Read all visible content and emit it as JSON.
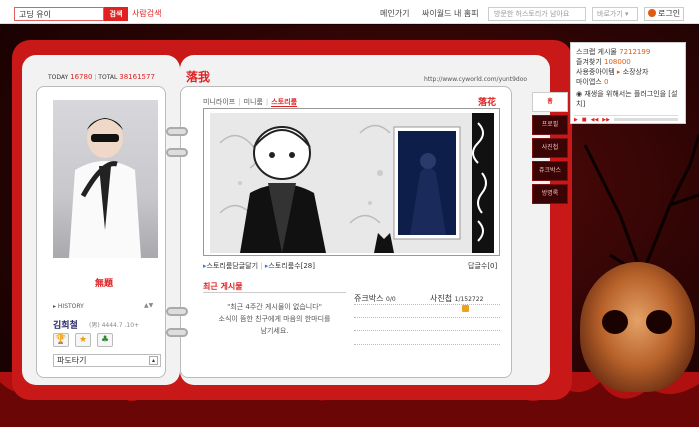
{
  "topbar": {
    "search_value": "고딩 유이",
    "search_button": "검색",
    "people_search": "사람검색",
    "main_link": "메인가기",
    "my_homepage": "싸이월드 내 홈피",
    "visitor_placeholder": "방문한 허스토리가 남아요",
    "goto_label": "바로가기",
    "login_label": "로그인"
  },
  "left": {
    "today_label": "TODAY",
    "today_count": "16780",
    "total_label": "TOTAL",
    "total_count": "38161577",
    "profile_name": "無題",
    "history_label": "HISTORY",
    "owner_name": "김희철",
    "owner_meta": "(男) 4444.7 .10+",
    "badges": [
      "🏆",
      "★",
      "♣"
    ],
    "pado_label": "파도타기"
  },
  "main": {
    "title": "落我",
    "url": "http://www.cyworld.com/yunt9doo",
    "tabs": [
      "미니라이프",
      "미니룸",
      "스토리룸"
    ],
    "tab_right": "落花",
    "story_link1": "스토리룸담글달기",
    "story_link2": "스토리룸수",
    "story_count": "[28]",
    "reply_count": "답글수[0]",
    "recent_title": "최근 게시물",
    "recent_line1": "\"최근 4주간 게시물이 없습니다\"",
    "recent_line2": "소식이 뜸한 친구에게 마음의 한마디를",
    "recent_line3": "남기세요.",
    "jukebox_label": "쥬크박스",
    "jukebox_value": "0/0",
    "photo_label": "사진첩",
    "photo_value": "1/152722"
  },
  "side_tabs": [
    "홈",
    "프로필",
    "사진첩",
    "쥬크박스",
    "방명록"
  ],
  "popup": {
    "line1_label": "스크랩 게시물",
    "line1_value": "7212199",
    "line2_label": "즐겨찾기",
    "line2_value": "108000",
    "line3_label": "사용중아이템",
    "line3_extra": "소장상자",
    "line4_label": "마이앱스",
    "line4_value": "0",
    "plugin": "재생을 위해서는 플러그인을 [설치]"
  },
  "colors": {
    "accent": "#e02222",
    "frame": "#c81818",
    "background": "#1a0202"
  }
}
